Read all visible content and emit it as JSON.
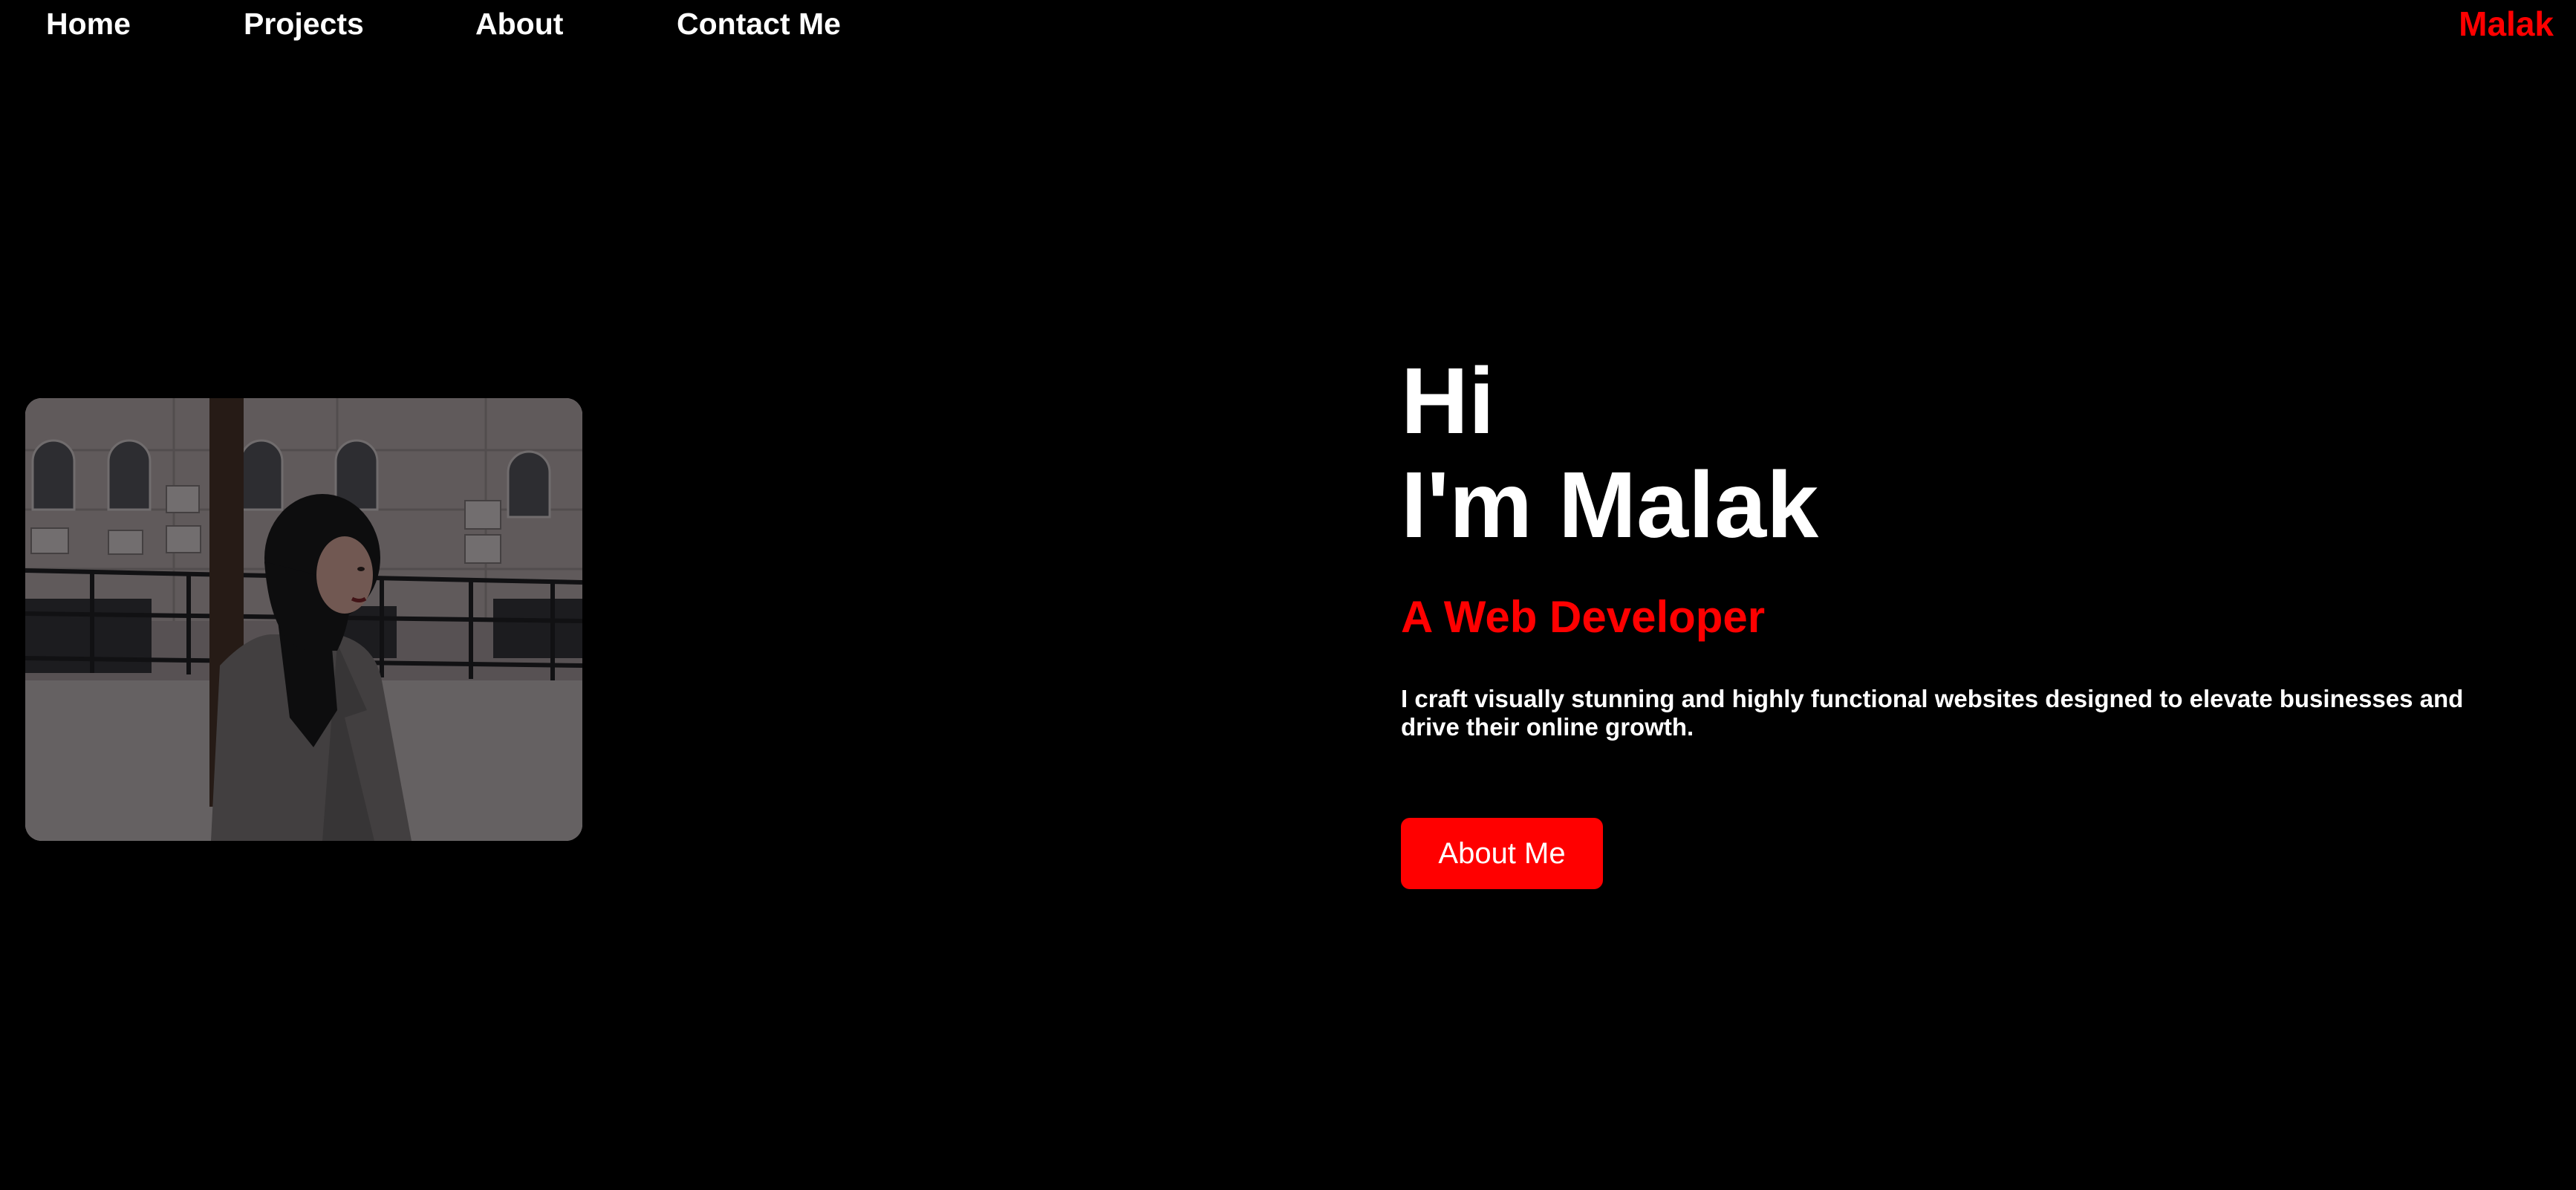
{
  "nav": {
    "links": [
      {
        "label": "Home"
      },
      {
        "label": "Projects"
      },
      {
        "label": "About"
      },
      {
        "label": "Contact Me"
      }
    ],
    "brand": "Malak"
  },
  "hero": {
    "greeting_line1": "Hi",
    "greeting_line2": "I'm Malak",
    "role": "A Web Developer",
    "intro": "I craft visually stunning and highly functional websites designed to elevate businesses and drive their online growth.",
    "cta_label": "About Me"
  },
  "colors": {
    "background": "#000000",
    "accent": "#ff0000",
    "text": "#ffffff"
  }
}
